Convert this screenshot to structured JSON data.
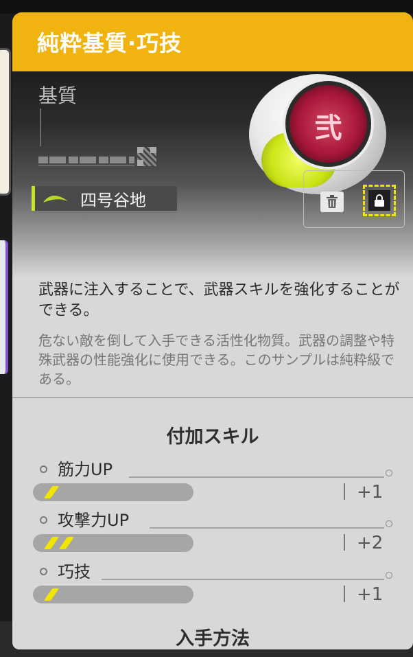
{
  "panel": {
    "title": "純粋基質·巧技",
    "type_label": "基質",
    "region": "四号谷地",
    "region_icon": "region-wave-icon",
    "accent_color": "#f0b30f",
    "marker_color": "#f2e500"
  },
  "actions": {
    "delete_icon": "trash-icon",
    "lock_icon": "lock-icon"
  },
  "description": {
    "main": "武器に注入することで、武器スキルを強化することができる。",
    "sub": "危ない敵を倒して入手できる活性化物質。武器の調整や特殊武器の性能強化に使用できる。このサンプルは純粋級である。"
  },
  "skills_section": {
    "title": "付加スキル",
    "skills": [
      {
        "name": "筋力UP",
        "level": 1,
        "value": "+1"
      },
      {
        "name": "攻撃力UP",
        "level": 2,
        "value": "+2"
      },
      {
        "name": "巧技",
        "level": 1,
        "value": "+1"
      }
    ]
  },
  "acquisition": {
    "title": "入手方法"
  }
}
